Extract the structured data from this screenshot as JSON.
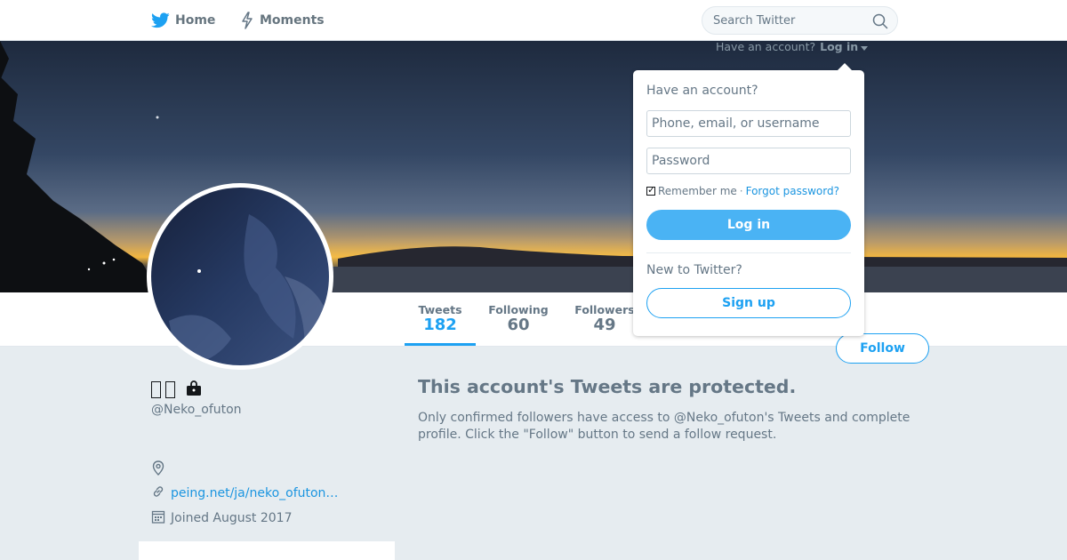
{
  "nav": {
    "home_label": "Home",
    "moments_label": "Moments",
    "search_placeholder": "Search Twitter"
  },
  "account_bar": {
    "prompt": "Have an account?",
    "login_label": "Log in"
  },
  "profile": {
    "display_name": "",
    "display_name_glyphs": 2,
    "handle": "@Neko_ofuton",
    "location": "",
    "url_text": "peing.net/ja/neko_ofuton…",
    "joined": "Joined August 2017",
    "sidebar_card_title": ""
  },
  "stats": [
    {
      "label": "Tweets",
      "value": "182"
    },
    {
      "label": "Following",
      "value": "60"
    },
    {
      "label": "Followers",
      "value": "49"
    }
  ],
  "follow_label": "Follow",
  "protected": {
    "title": "This account's Tweets are protected.",
    "body": "Only confirmed followers have access to @Neko_ofuton's Tweets and complete profile. Click the \"Follow\" button to send a follow request."
  },
  "login_dropdown": {
    "heading": "Have an account?",
    "username_placeholder": "Phone, email, or username",
    "password_placeholder": "Password",
    "remember_label": "Remember me",
    "separator": "·",
    "forgot_label": "Forgot password?",
    "login_button": "Log in",
    "new_prompt": "New to Twitter?",
    "signup_button": "Sign up"
  },
  "colors": {
    "accent": "#1da1f2",
    "page_bg": "#e6ecf0",
    "muted_text": "#657786"
  },
  "icons": [
    "twitter-bird-icon",
    "moments-bolt-icon",
    "search-icon",
    "caret-down-icon",
    "lock-icon",
    "location-pin-icon",
    "link-icon",
    "calendar-icon"
  ]
}
